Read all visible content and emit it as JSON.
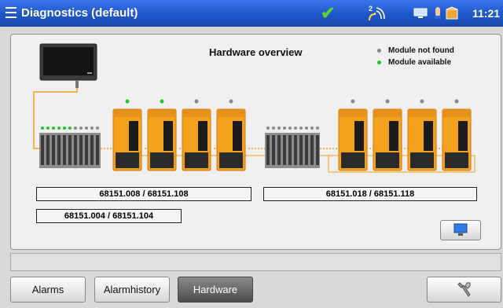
{
  "header": {
    "title": "Diagnostics (default)",
    "time": "11:21",
    "network_badge": "2"
  },
  "panel": {
    "title": "Hardware overview",
    "legend": [
      {
        "label": "Module not found",
        "color": "#888888"
      },
      {
        "label": "Module available",
        "color": "#22c52a"
      }
    ],
    "labels": {
      "group1": "68151.008 / 68151.108",
      "group1_sub": "68151.004 / 68151.104",
      "group2": "68151.018 / 68151.118"
    }
  },
  "footer": {
    "alarms": "Alarms",
    "alarmhistory": "Alarmhistory",
    "hardware": "Hardware"
  },
  "colors": {
    "accent": "#1f56c9",
    "module_orange": "#f4a11d",
    "cable": "#f4a11d"
  }
}
